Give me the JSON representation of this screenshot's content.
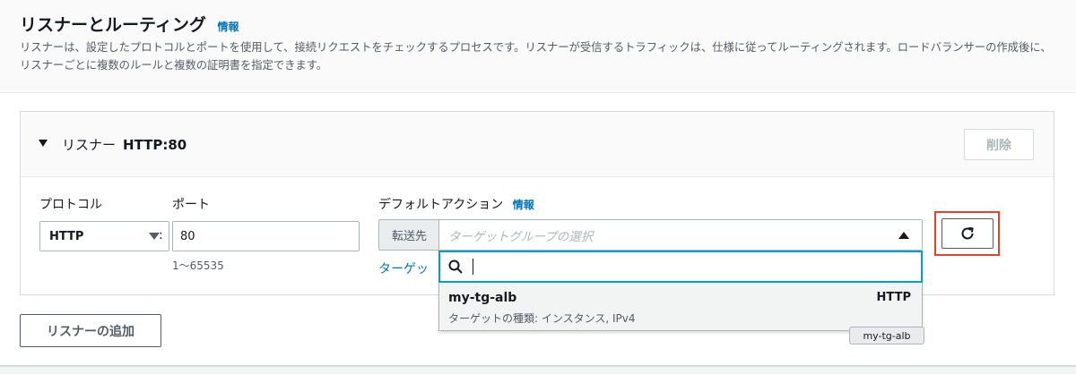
{
  "section": {
    "title": "リスナーとルーティング",
    "info_label": "情報",
    "description": "リスナーは、設定したプロトコルとポートを使用して、接続リクエストをチェックするプロセスです。リスナーが受信するトラフィックは、仕様に従ってルーティングされます。ロードバランサーの作成後に、リスナーごとに複数のルールと複数の証明書を指定できます。"
  },
  "listener": {
    "prefix": "リスナー",
    "name": "HTTP:80",
    "delete_label": "削除",
    "protocol_label": "プロトコル",
    "protocol_value": "HTTP",
    "colon": ":",
    "port_label": "ポート",
    "port_value": "80",
    "port_hint": "1〜65535",
    "default_action_label": "デフォルトアクション",
    "default_action_info": "情報",
    "forward_prefix": "転送先",
    "target_group_placeholder": "ターゲットグループの選択",
    "target_group_link": "ターゲッ",
    "search_value": "",
    "options": [
      {
        "name": "my-tg-alb",
        "protocol": "HTTP",
        "desc": "ターゲットの種類: インスタンス, IPv4"
      }
    ],
    "tooltip": "my-tg-alb"
  },
  "add_listener_label": "リスナーの追加",
  "colors": {
    "link": "#0073bb",
    "focus": "#00a1c9",
    "highlight": "#e0442c"
  }
}
